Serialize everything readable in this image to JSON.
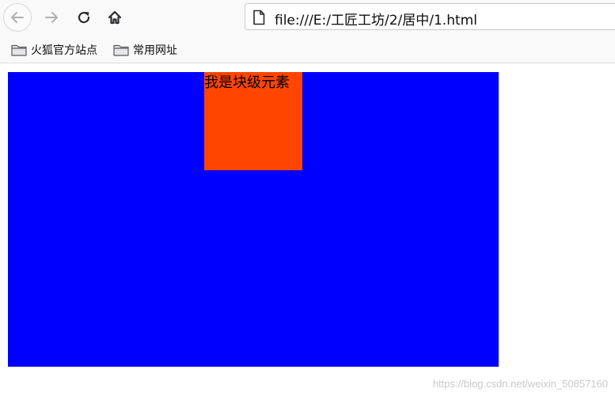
{
  "browser": {
    "url": "file:///E:/工匠工坊/2/居中/1.html",
    "bookmarks": [
      "火狐官方站点",
      "常用网址"
    ],
    "icons": {
      "back": "arrow-left-icon",
      "forward": "arrow-right-icon",
      "reload": "reload-icon",
      "home": "home-icon",
      "page": "page-icon",
      "folder": "folder-icon"
    }
  },
  "page": {
    "outer_color": "#0000ff",
    "inner_color": "#ff4500",
    "inner_text": "我是块级元素"
  },
  "watermark": "https://blog.csdn.net/weixin_50857160"
}
